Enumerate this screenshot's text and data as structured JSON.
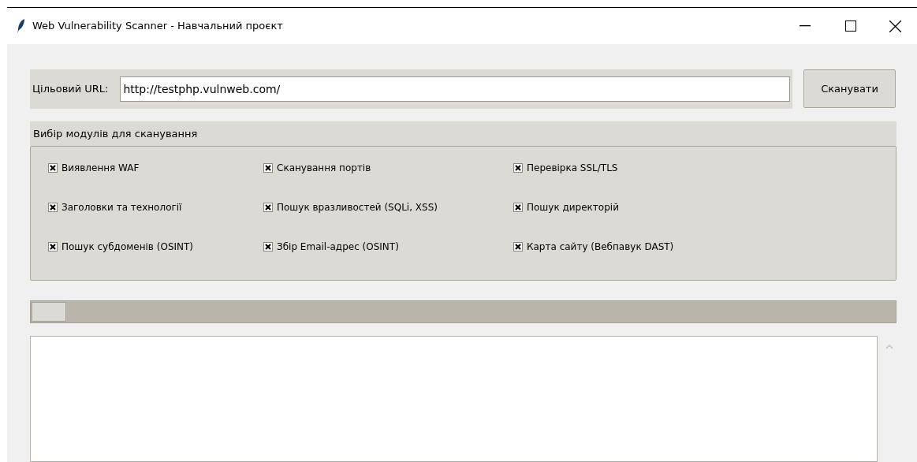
{
  "window": {
    "title": "Web Vulnerability Scanner - Навчальний проєкт"
  },
  "url_bar": {
    "label": "Цільовий URL:",
    "value": "http://testphp.vulnweb.com/",
    "button": "Сканувати"
  },
  "modules": {
    "title": "Вибір модулів для сканування",
    "items": [
      {
        "label": "Виявлення WAF",
        "checked": true
      },
      {
        "label": "Сканування портів",
        "checked": true
      },
      {
        "label": "Перевірка SSL/TLS",
        "checked": true
      },
      {
        "label": "Заголовки та технології",
        "checked": true
      },
      {
        "label": "Пошук вразливостей (SQLi, XSS)",
        "checked": true
      },
      {
        "label": "Пошук директорій",
        "checked": true
      },
      {
        "label": "Пошук субдоменів (OSINT)",
        "checked": true
      },
      {
        "label": "Збір Email-адрес (OSINT)",
        "checked": true
      },
      {
        "label": "Карта сайту (Вебпавук DAST)",
        "checked": true
      }
    ]
  },
  "progress": {
    "level": 0.04
  }
}
